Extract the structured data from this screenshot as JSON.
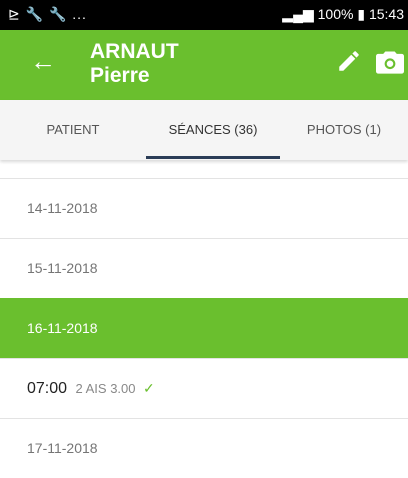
{
  "status_bar": {
    "left_icons": "⊵ 🔧 🔧 ...",
    "battery": "100%",
    "time": "15:43"
  },
  "header": {
    "last_name": "ARNAUT",
    "first_name": "Pierre",
    "icons": [
      "arrow-back-icon",
      "pencil-icon",
      "camera-icon"
    ]
  },
  "tabs": [
    {
      "label": "PATIENT"
    },
    {
      "label": "SÉANCES (36)"
    },
    {
      "label": "PHOTOS (1)"
    }
  ],
  "list": {
    "dates": [
      "14-11-2018",
      "15-11-2018",
      "16-11-2018",
      "17-11-2018"
    ],
    "session": {
      "time": "07:00",
      "detail": "2 AIS 3.00"
    }
  },
  "colors": {
    "accent": "#6abf2e",
    "tab_indicator": "#2b3d57"
  }
}
